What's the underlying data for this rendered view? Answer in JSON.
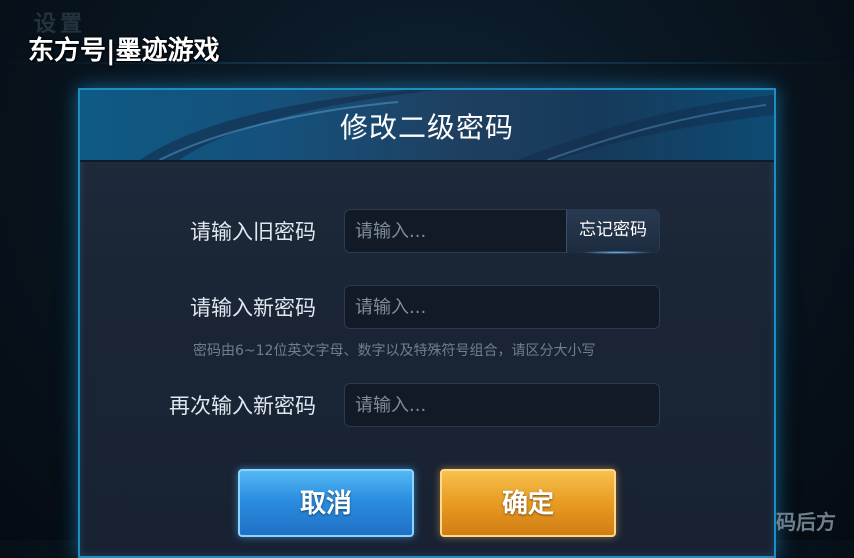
{
  "background": {
    "title": "设置"
  },
  "watermark": {
    "top": "东方号|墨迹游戏",
    "bottom": "码后方"
  },
  "dialog": {
    "title": "修改二级密码",
    "old_password": {
      "label": "请输入旧密码",
      "placeholder": "请输入...",
      "forgot_label": "忘记密码"
    },
    "new_password": {
      "label": "请输入新密码",
      "placeholder": "请输入...",
      "hint": "密码由6~12位英文字母、数字以及特殊符号组合，请区分大小写"
    },
    "confirm_password": {
      "label": "再次输入新密码",
      "placeholder": "请输入..."
    },
    "buttons": {
      "cancel": "取消",
      "confirm": "确定"
    }
  },
  "colors": {
    "accent_border": "#1e8ec2",
    "cancel_button": "#2b8ee0",
    "confirm_button": "#e89b22",
    "panel_bg": "#1a2535"
  }
}
